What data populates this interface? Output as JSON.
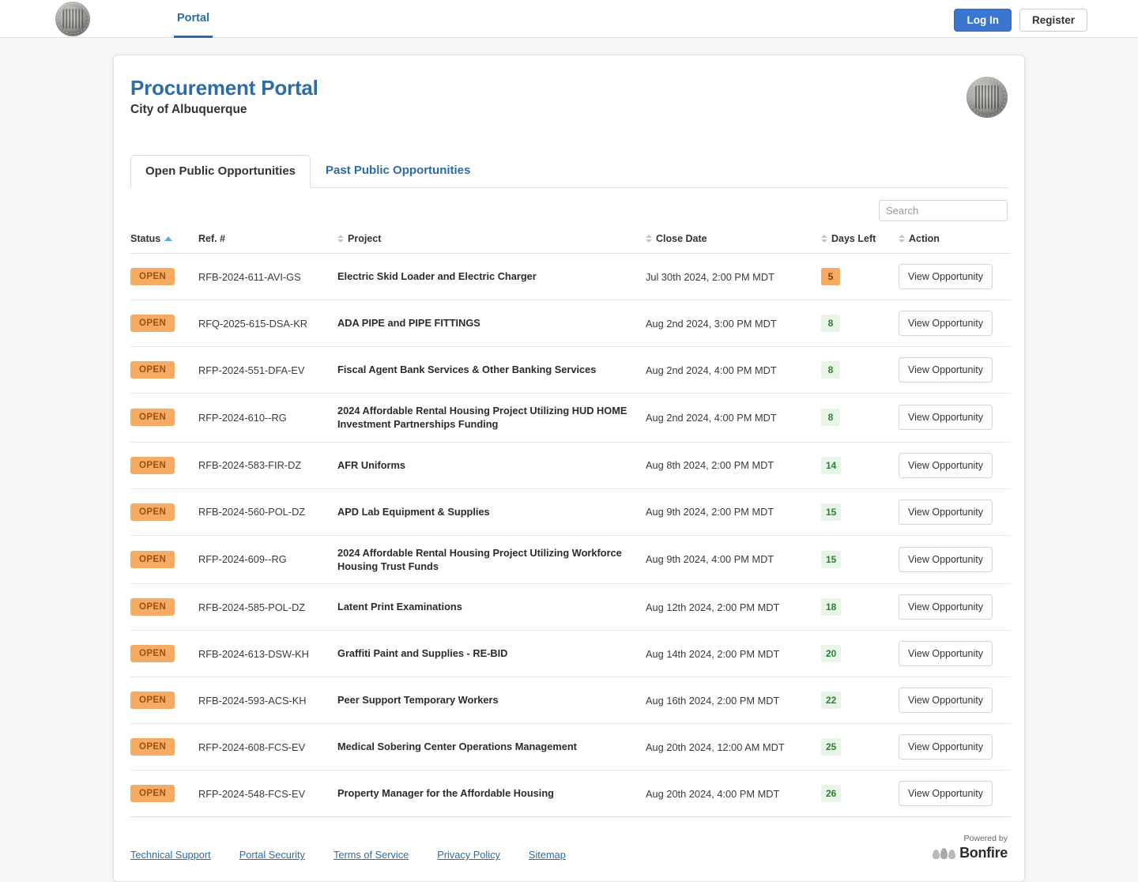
{
  "topnav": {
    "logo_icon": "city-seal-icon",
    "tabs": [
      {
        "label": "Portal"
      }
    ],
    "login_label": "Log In",
    "register_label": "Register"
  },
  "header": {
    "title": "Procurement Portal",
    "subtitle": "City of Albuquerque",
    "seal_icon": "city-seal-icon"
  },
  "tabs": [
    {
      "label": "Open Public Opportunities",
      "active": true
    },
    {
      "label": "Past Public Opportunities",
      "active": false
    }
  ],
  "search": {
    "placeholder": "Search",
    "value": ""
  },
  "table": {
    "columns": {
      "status": "Status",
      "ref": "Ref. #",
      "project": "Project",
      "close_date": "Close Date",
      "days_left": "Days Left",
      "action": "Action"
    },
    "sort": {
      "column": "Status",
      "direction": "asc"
    },
    "action_label": "View Opportunity",
    "rows": [
      {
        "status": "OPEN",
        "ref": "RFB-2024-611-AVI-GS",
        "project": "Electric Skid Loader and Electric Charger",
        "close_date": "Jul 30th 2024, 2:00 PM MDT",
        "days_left": "5",
        "days_color": "orange"
      },
      {
        "status": "OPEN",
        "ref": "RFQ-2025-615-DSA-KR",
        "project": "ADA PIPE and PIPE FITTINGS",
        "close_date": "Aug 2nd 2024, 3:00 PM MDT",
        "days_left": "8",
        "days_color": "green"
      },
      {
        "status": "OPEN",
        "ref": "RFP-2024-551-DFA-EV",
        "project": "Fiscal Agent Bank Services & Other Banking Services",
        "close_date": "Aug 2nd 2024, 4:00 PM MDT",
        "days_left": "8",
        "days_color": "green"
      },
      {
        "status": "OPEN",
        "ref": "RFP-2024-610--RG",
        "project": "2024 Affordable Rental Housing Project Utilizing HUD HOME Investment Partnerships Funding",
        "close_date": "Aug 2nd 2024, 4:00 PM MDT",
        "days_left": "8",
        "days_color": "green"
      },
      {
        "status": "OPEN",
        "ref": "RFB-2024-583-FIR-DZ",
        "project": "AFR Uniforms",
        "close_date": "Aug 8th 2024, 2:00 PM MDT",
        "days_left": "14",
        "days_color": "green"
      },
      {
        "status": "OPEN",
        "ref": "RFB-2024-560-POL-DZ",
        "project": "APD Lab Equipment & Supplies",
        "close_date": "Aug 9th 2024, 2:00 PM MDT",
        "days_left": "15",
        "days_color": "green"
      },
      {
        "status": "OPEN",
        "ref": "RFP-2024-609--RG",
        "project": "2024 Affordable Rental Housing Project Utilizing Workforce Housing Trust Funds",
        "close_date": "Aug 9th 2024, 4:00 PM MDT",
        "days_left": "15",
        "days_color": "green"
      },
      {
        "status": "OPEN",
        "ref": "RFB-2024-585-POL-DZ",
        "project": "Latent Print Examinations",
        "close_date": "Aug 12th 2024, 2:00 PM MDT",
        "days_left": "18",
        "days_color": "green"
      },
      {
        "status": "OPEN",
        "ref": "RFB-2024-613-DSW-KH",
        "project": "Graffiti Paint and Supplies - RE-BID",
        "close_date": "Aug 14th 2024, 2:00 PM MDT",
        "days_left": "20",
        "days_color": "green"
      },
      {
        "status": "OPEN",
        "ref": "RFB-2024-593-ACS-KH",
        "project": "Peer Support Temporary Workers",
        "close_date": "Aug 16th 2024, 2:00 PM MDT",
        "days_left": "22",
        "days_color": "green"
      },
      {
        "status": "OPEN",
        "ref": "RFP-2024-608-FCS-EV",
        "project": "Medical Sobering Center Operations Management",
        "close_date": "Aug 20th 2024, 12:00 AM MDT",
        "days_left": "25",
        "days_color": "green"
      },
      {
        "status": "OPEN",
        "ref": "RFP-2024-548-FCS-EV",
        "project": "Property Manager for the Affordable Housing",
        "close_date": "Aug 20th 2024, 4:00 PM MDT",
        "days_left": "26",
        "days_color": "green"
      }
    ]
  },
  "footer": {
    "links": [
      {
        "label": "Technical Support"
      },
      {
        "label": "Portal Security"
      },
      {
        "label": "Terms of Service"
      },
      {
        "label": "Privacy Policy"
      },
      {
        "label": "Sitemap"
      }
    ],
    "powered_by": "Powered by",
    "brand": "Bonfire",
    "brand_icon": "bonfire-flames-icon"
  },
  "colors": {
    "accent_blue": "#2c6ca8",
    "login_blue": "#3a76cf",
    "open_badge": "#f5ab61",
    "days_green_bg": "#e7f4e7",
    "days_green_text": "#2f7d32",
    "sort_active": "#5bacd6"
  }
}
